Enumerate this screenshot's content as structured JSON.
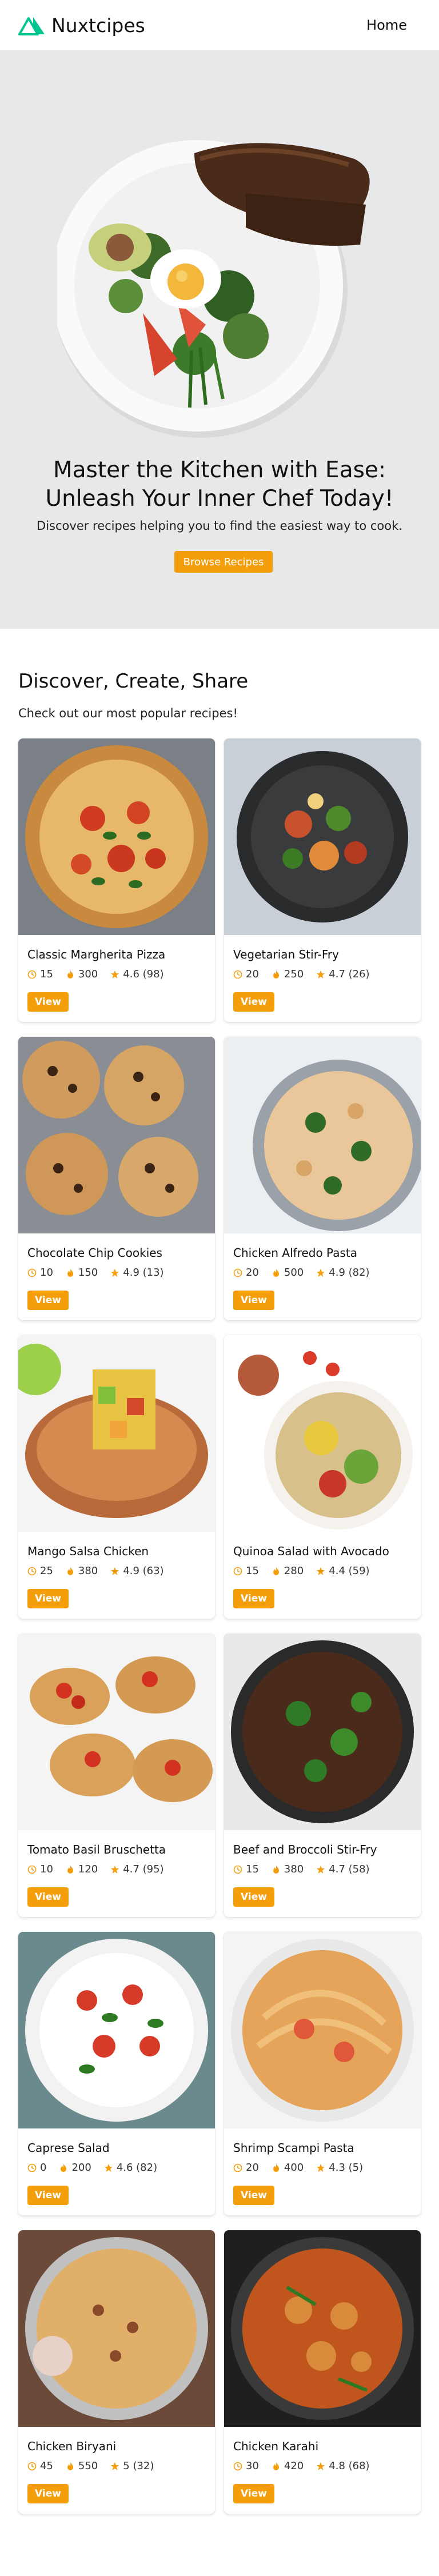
{
  "header": {
    "brand": "Nuxtcipes",
    "nav_home": "Home"
  },
  "hero": {
    "title_line1": "Master the Kitchen  with Ease:",
    "title_line2": "Unleash  Your Inner Chef Today!",
    "subtitle": "Discover recipes helping you to find the easiest way to cook.",
    "button": "Browse Recipes"
  },
  "section": {
    "title": "Discover, Create, Share",
    "subtitle": "Check out our most popular recipes!"
  },
  "colors": {
    "accent": "#f59e0b",
    "brand_green": "#00c58e",
    "brand_dark": "#003543",
    "hero_bg": "#e7e8ea"
  },
  "recipes": [
    {
      "title": "Classic Margherita Pizza",
      "time": "15",
      "calories": "300",
      "rating": "4.6 (98)",
      "view": "View"
    },
    {
      "title": "Vegetarian Stir-Fry",
      "time": "20",
      "calories": "250",
      "rating": "4.7 (26)",
      "view": "View"
    },
    {
      "title": "Chocolate Chip Cookies",
      "time": "10",
      "calories": "150",
      "rating": "4.9 (13)",
      "view": "View"
    },
    {
      "title": "Chicken Alfredo Pasta",
      "time": "20",
      "calories": "500",
      "rating": "4.9 (82)",
      "view": "View"
    },
    {
      "title": "Mango Salsa Chicken",
      "time": "25",
      "calories": "380",
      "rating": "4.9 (63)",
      "view": "View"
    },
    {
      "title": "Quinoa Salad with Avocado",
      "time": "15",
      "calories": "280",
      "rating": "4.4 (59)",
      "view": "View"
    },
    {
      "title": "Tomato Basil Bruschetta",
      "time": "10",
      "calories": "120",
      "rating": "4.7 (95)",
      "view": "View"
    },
    {
      "title": "Beef and Broccoli Stir-Fry",
      "time": "15",
      "calories": "380",
      "rating": "4.7 (58)",
      "view": "View"
    },
    {
      "title": "Caprese Salad",
      "time": "0",
      "calories": "200",
      "rating": "4.6 (82)",
      "view": "View"
    },
    {
      "title": "Shrimp Scampi Pasta",
      "time": "20",
      "calories": "400",
      "rating": "4.3 (5)",
      "view": "View"
    },
    {
      "title": "Chicken Biryani",
      "time": "45",
      "calories": "550",
      "rating": "5 (32)",
      "view": "View"
    },
    {
      "title": "Chicken Karahi",
      "time": "30",
      "calories": "420",
      "rating": "4.8 (68)",
      "view": "View"
    }
  ]
}
